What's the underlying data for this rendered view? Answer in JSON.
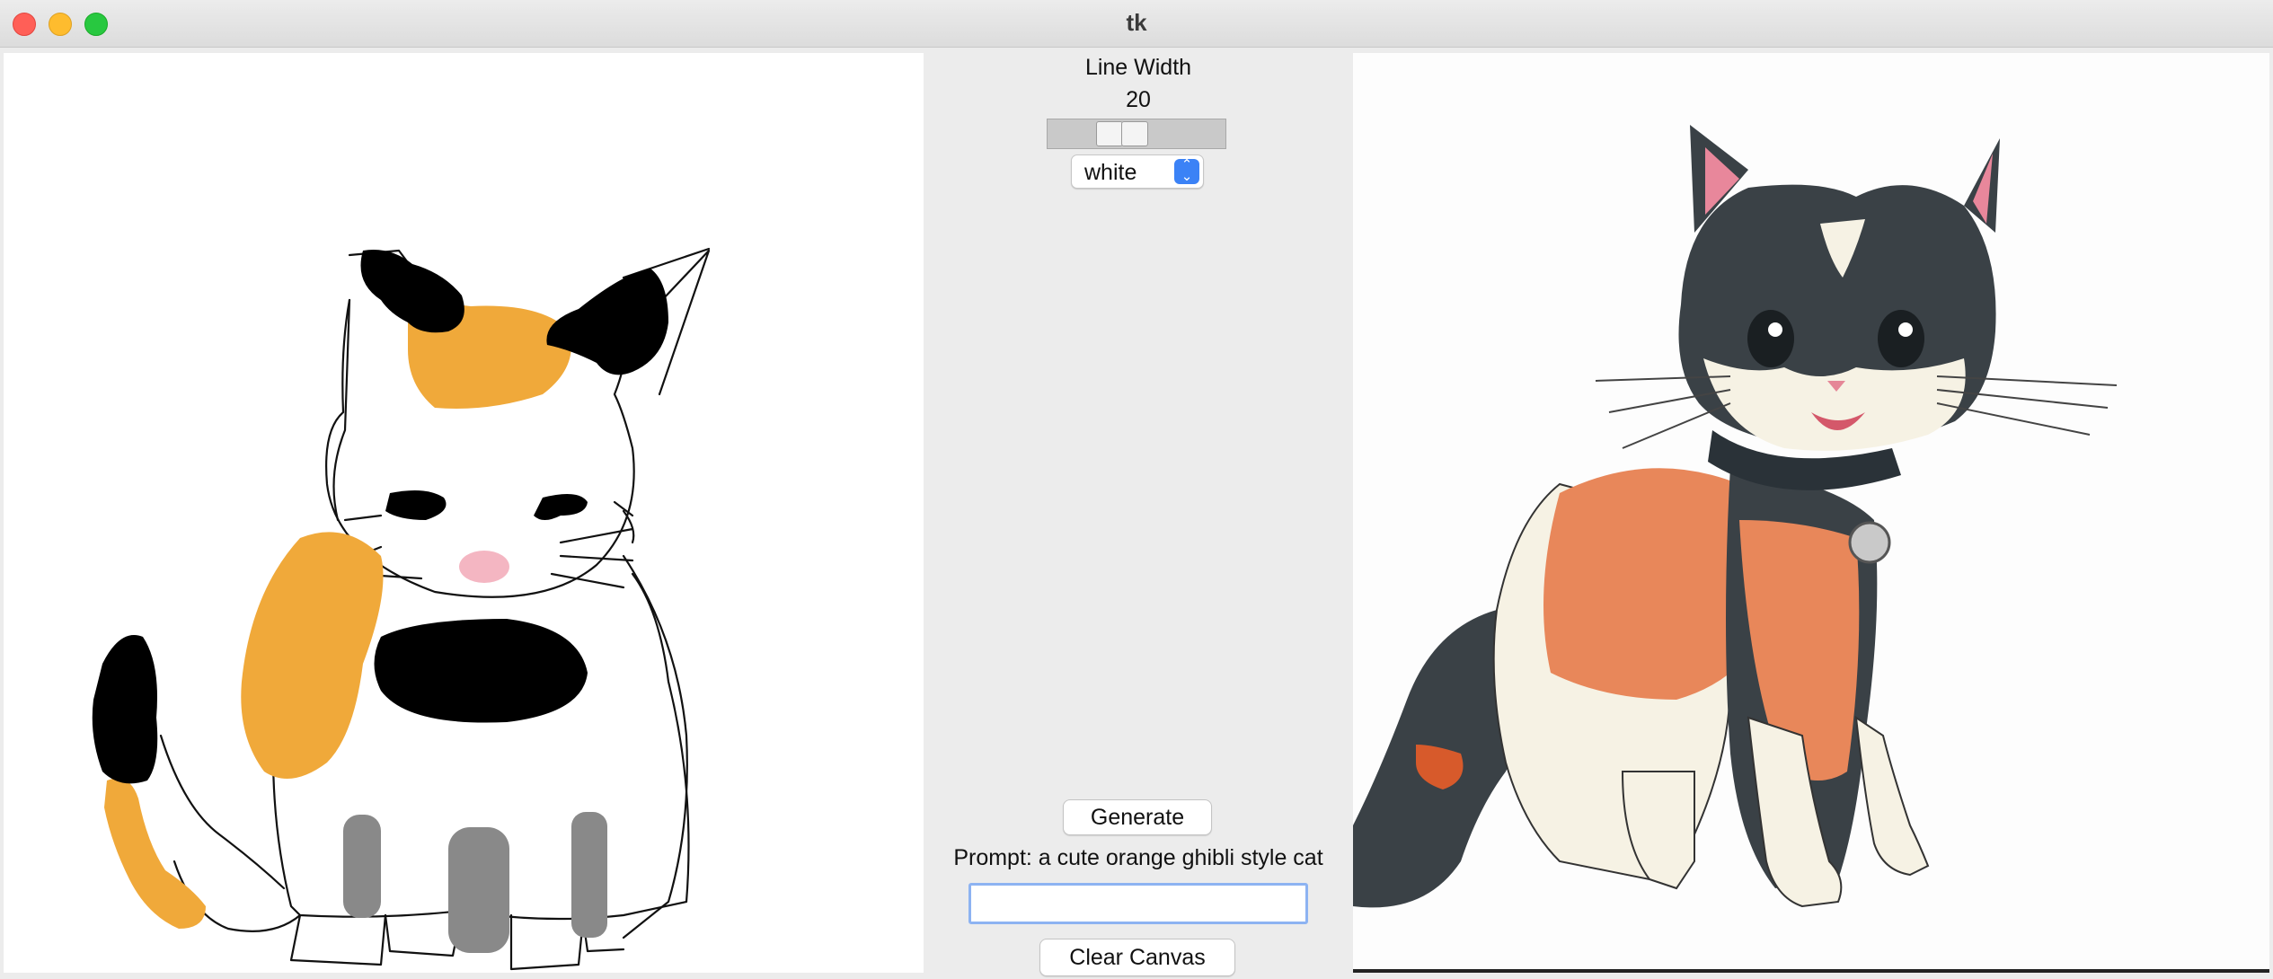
{
  "window": {
    "title": "tk"
  },
  "controls": {
    "line_width_label": "Line Width",
    "line_width_value": "20",
    "line_width_value_num": 20,
    "color_selected": "white",
    "generate_label": "Generate",
    "prompt_label": "Prompt: a cute orange ghibli style cat",
    "prompt_input_value": "",
    "clear_label": "Clear Canvas"
  },
  "colors": {
    "window_bg": "#ececec",
    "canvas_bg": "#ffffff",
    "accent_blue": "#3b82f6",
    "traffic_close": "#ff5f57",
    "traffic_min": "#febc2e",
    "traffic_max": "#28c840"
  }
}
